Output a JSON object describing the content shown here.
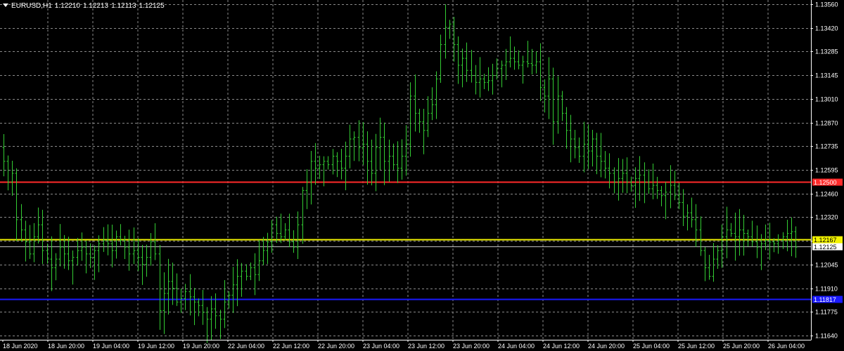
{
  "header": {
    "symbol": "EURUSD,H1",
    "open": "1.12210",
    "high": "1.12213",
    "low": "1.12113",
    "close": "1.12125"
  },
  "colors": {
    "background": "#000000",
    "grid": "#8a8a8a",
    "bars": "#33cc33",
    "axis_text": "#ffffff",
    "red_line": "#ff2a2a",
    "yellow_line": "#f2f200",
    "blue_line": "#1a1aff",
    "bid_line": "#c0c0c0"
  },
  "chart_data": {
    "type": "ohlc",
    "ylim": [
      1.1158,
      1.1356
    ],
    "grid": true,
    "y_ticks": [
      "1.13560",
      "1.13420",
      "1.13285",
      "1.13145",
      "1.13010",
      "1.12870",
      "1.12735",
      "1.12595",
      "1.12460",
      "1.12320",
      "1.12185",
      "1.12045",
      "1.11910",
      "1.11775",
      "1.11640"
    ],
    "x_ticks": [
      "18 Jun 2020",
      "18 Jun 20:00",
      "19 Jun 04:00",
      "19 Jun 12:00",
      "19 Jun 20:00",
      "22 Jun 04:00",
      "22 Jun 12:00",
      "22 Jun 20:00",
      "23 Jun 04:00",
      "23 Jun 12:00",
      "23 Jun 20:00",
      "24 Jun 04:00",
      "24 Jun 12:00",
      "24 Jun 20:00",
      "25 Jun 04:00",
      "25 Jun 12:00",
      "25 Jun 20:00",
      "26 Jun 04:00"
    ],
    "levels": [
      {
        "label": "1.12500",
        "value": 1.125,
        "color": "#ff2a2a"
      },
      {
        "label": "1.12167",
        "value": 1.12167,
        "color": "#f2f200"
      },
      {
        "label": "1.11817",
        "value": 1.11817,
        "color": "#1a1aff"
      },
      {
        "label": "1.12125",
        "value": 1.12125,
        "color": "#c0c0c0"
      }
    ],
    "close_series": [
      1.1262,
      1.125,
      1.1255,
      1.1228,
      1.1222,
      1.1215,
      1.1208,
      1.1218,
      1.1225,
      1.121,
      1.1205,
      1.12,
      1.1205,
      1.1212,
      1.1208,
      1.1204,
      1.1206,
      1.121,
      1.1212,
      1.1208,
      1.1206,
      1.121,
      1.1214,
      1.1216,
      1.1214,
      1.121,
      1.1218,
      1.1216,
      1.1212,
      1.1208,
      1.121,
      1.1206,
      1.1202,
      1.1206,
      1.1215,
      1.1208,
      1.1175,
      1.1185,
      1.1192,
      1.1188,
      1.118,
      1.1182,
      1.1186,
      1.1183,
      1.118,
      1.1178,
      1.1174,
      1.117,
      1.1176,
      1.1172,
      1.117,
      1.118,
      1.1184,
      1.119,
      1.1195,
      1.1198,
      1.1195,
      1.12,
      1.1196,
      1.1204,
      1.121,
      1.1215,
      1.1225,
      1.122,
      1.1218,
      1.1222,
      1.1215,
      1.1212,
      1.1225,
      1.1245,
      1.125,
      1.1262,
      1.1258,
      1.126,
      1.1262,
      1.126,
      1.1265,
      1.1262,
      1.1258,
      1.1265,
      1.1275,
      1.1276,
      1.127,
      1.1272,
      1.1262,
      1.1255,
      1.127,
      1.1276,
      1.1262,
      1.1265,
      1.126,
      1.1258,
      1.1265,
      1.1272,
      1.13,
      1.129,
      1.1285,
      1.128,
      1.129,
      1.1295,
      1.131,
      1.133,
      1.134,
      1.1342,
      1.133,
      1.1318,
      1.1322,
      1.1315,
      1.1312,
      1.1308,
      1.131,
      1.1308,
      1.1309,
      1.1312,
      1.1316,
      1.1318,
      1.132,
      1.1322,
      1.132,
      1.1318,
      1.132,
      1.1319,
      1.1318,
      1.132,
      1.1305,
      1.13,
      1.131,
      1.1285,
      1.13,
      1.129,
      1.128,
      1.1275,
      1.127,
      1.1265,
      1.1272,
      1.1268,
      1.1275,
      1.1265,
      1.1262,
      1.1258,
      1.1255,
      1.125,
      1.1252,
      1.1255,
      1.125,
      1.1248,
      1.1252,
      1.1254,
      1.125,
      1.1246,
      1.1248,
      1.1245,
      1.1242,
      1.1244,
      1.1248,
      1.1242,
      1.1238,
      1.123,
      1.1232,
      1.1228,
      1.1222,
      1.121,
      1.12,
      1.1195,
      1.1205,
      1.121,
      1.1218,
      1.1222,
      1.122,
      1.1218,
      1.1222,
      1.122,
      1.1218,
      1.1215,
      1.1212,
      1.1214,
      1.1216,
      1.1215,
      1.1214,
      1.1216,
      1.1218,
      1.122,
      1.1221,
      1.1212
    ]
  }
}
